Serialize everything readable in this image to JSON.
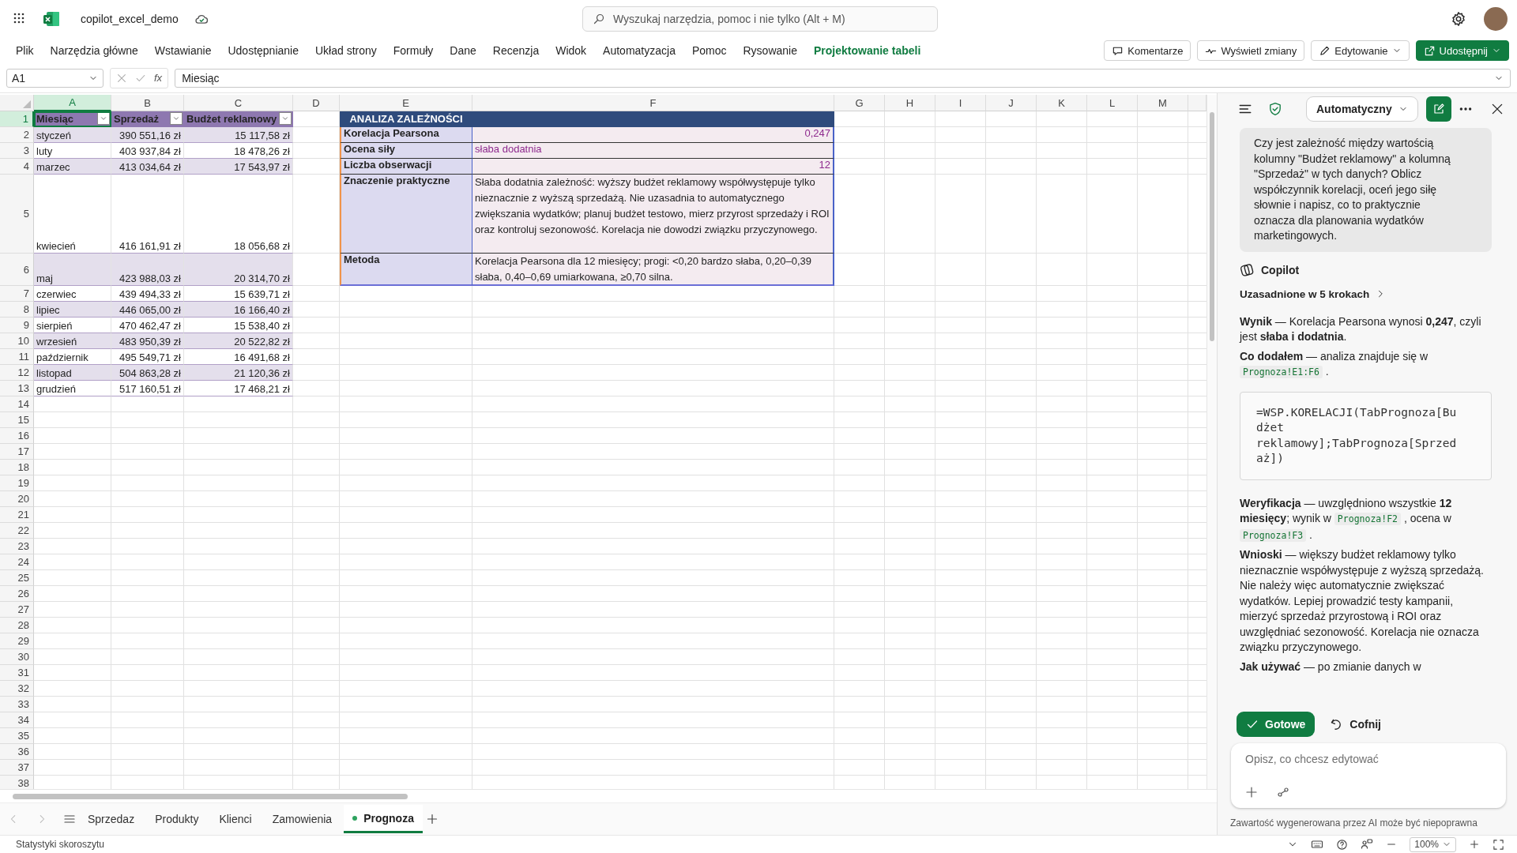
{
  "app": {
    "title": "copilot_excel_demo"
  },
  "search": {
    "placeholder": "Wyszukaj narzędzia, pomoc i nie tylko (Alt + M)"
  },
  "ribbon": {
    "tabs": [
      {
        "label": "Plik",
        "kind": "normal"
      },
      {
        "label": "Narzędzia główne",
        "kind": "normal"
      },
      {
        "label": "Wstawianie",
        "kind": "normal"
      },
      {
        "label": "Udostępnianie",
        "kind": "normal"
      },
      {
        "label": "Układ strony",
        "kind": "normal"
      },
      {
        "label": "Formuły",
        "kind": "normal"
      },
      {
        "label": "Dane",
        "kind": "normal"
      },
      {
        "label": "Recenzja",
        "kind": "normal"
      },
      {
        "label": "Widok",
        "kind": "normal"
      },
      {
        "label": "Automatyzacja",
        "kind": "normal"
      },
      {
        "label": "Pomoc",
        "kind": "normal"
      },
      {
        "label": "Rysowanie",
        "kind": "normal"
      },
      {
        "label": "Projektowanie tabeli",
        "kind": "contextual"
      }
    ],
    "actions": [
      {
        "label": "Komentarze",
        "kind": "comments"
      },
      {
        "label": "Wyświetl zmiany",
        "kind": "changes"
      },
      {
        "label": "Edytowanie",
        "kind": "mode"
      },
      {
        "label": "Udostępnij",
        "kind": "share"
      }
    ]
  },
  "formula_bar": {
    "name_box": "A1",
    "function_label": "fx",
    "value": "Miesiąc"
  },
  "sheet": {
    "columns": [
      {
        "label": "A",
        "selected": true
      },
      {
        "label": "B",
        "selected": false
      },
      {
        "label": "C",
        "selected": false
      },
      {
        "label": "D",
        "selected": false
      },
      {
        "label": "E",
        "selected": false
      },
      {
        "label": "F",
        "selected": false
      },
      {
        "label": "G",
        "selected": false
      },
      {
        "label": "H",
        "selected": false
      },
      {
        "label": "I",
        "selected": false
      },
      {
        "label": "J",
        "selected": false
      },
      {
        "label": "K",
        "selected": false
      },
      {
        "label": "L",
        "selected": false
      },
      {
        "label": "M",
        "selected": false
      }
    ],
    "rows": [
      {
        "label": "1",
        "selected": true
      },
      {
        "label": "2",
        "selected": false
      },
      {
        "label": "3",
        "selected": false
      },
      {
        "label": "4",
        "selected": false
      },
      {
        "label": "5",
        "selected": false
      },
      {
        "label": "6",
        "selected": false
      },
      {
        "label": "7",
        "selected": false
      },
      {
        "label": "8",
        "selected": false
      },
      {
        "label": "9",
        "selected": false
      },
      {
        "label": "10",
        "selected": false
      },
      {
        "label": "11",
        "selected": false
      },
      {
        "label": "12",
        "selected": false
      },
      {
        "label": "13",
        "selected": false
      },
      {
        "label": "14",
        "selected": false
      },
      {
        "label": "15",
        "selected": false
      },
      {
        "label": "16",
        "selected": false
      },
      {
        "label": "17",
        "selected": false
      },
      {
        "label": "18",
        "selected": false
      },
      {
        "label": "19",
        "selected": false
      },
      {
        "label": "20",
        "selected": false
      },
      {
        "label": "21",
        "selected": false
      },
      {
        "label": "22",
        "selected": false
      },
      {
        "label": "23",
        "selected": false
      },
      {
        "label": "24",
        "selected": false
      },
      {
        "label": "25",
        "selected": false
      },
      {
        "label": "26",
        "selected": false
      },
      {
        "label": "27",
        "selected": false
      },
      {
        "label": "28",
        "selected": false
      },
      {
        "label": "29",
        "selected": false
      },
      {
        "label": "30",
        "selected": false
      },
      {
        "label": "31",
        "selected": false
      },
      {
        "label": "32",
        "selected": false
      },
      {
        "label": "33",
        "selected": false
      },
      {
        "label": "34",
        "selected": false
      },
      {
        "label": "35",
        "selected": false
      },
      {
        "label": "36",
        "selected": false
      },
      {
        "label": "37",
        "selected": false
      },
      {
        "label": "38",
        "selected": false
      }
    ],
    "table": {
      "headers": [
        "Miesiąc",
        "Sprzedaż",
        "Budżet reklamowy"
      ],
      "rows": [
        [
          "styczeń",
          "390 551,16 zł",
          "15 117,58 zł"
        ],
        [
          "luty",
          "403 937,84 zł",
          "18 478,26 zł"
        ],
        [
          "marzec",
          "413 034,64 zł",
          "17 543,97 zł"
        ],
        [
          "kwiecień",
          "416 161,91 zł",
          "18 056,68 zł"
        ],
        [
          "maj",
          "423 988,03 zł",
          "20 314,70 zł"
        ],
        [
          "czerwiec",
          "439 494,33 zł",
          "15 639,71 zł"
        ],
        [
          "lipiec",
          "446 065,00 zł",
          "16 166,40 zł"
        ],
        [
          "sierpień",
          "470 462,47 zł",
          "15 538,40 zł"
        ],
        [
          "wrzesień",
          "483 950,39 zł",
          "20 522,82 zł"
        ],
        [
          "październik",
          "495 549,71 zł",
          "16 491,68 zł"
        ],
        [
          "listopad",
          "504 863,28 zł",
          "21 120,36 zł"
        ],
        [
          "grudzień",
          "517 160,51 zł",
          "17 468,21 zł"
        ]
      ]
    },
    "analysis": {
      "title": "ANALIZA ZALEŻNOŚCI",
      "rows": [
        {
          "label": "Korelacja Pearsona",
          "value": "0,247",
          "kind": "number"
        },
        {
          "label": "Ocena siły",
          "value": "słaba dodatnia",
          "kind": "rating"
        },
        {
          "label": "Liczba obserwacji",
          "value": "12",
          "kind": "number"
        },
        {
          "label": "Znaczenie praktyczne",
          "value": "Słaba dodatnia zależność: wyższy budżet reklamowy współwystępuje tylko nieznacznie z wyższą sprzedażą. Nie uzasadnia to automatycznego zwiększania wydatków; planuj budżet testowo, mierz przyrost sprzedaży i ROI oraz kontroluj sezonowość. Korelacja nie dowodzi związku przyczynowego.",
          "kind": "note"
        },
        {
          "label": "Metoda",
          "value": "Korelacja Pearsona dla 12 miesięcy; progi: <0,20 bardzo słaba, 0,20–0,39 słaba, 0,40–0,69 umiarkowana, ≥0,70 silna.",
          "kind": "note"
        }
      ]
    }
  },
  "sheet_tabs": [
    {
      "label": "Sprzedaz",
      "selected": false
    },
    {
      "label": "Produkty",
      "selected": false
    },
    {
      "label": "Klienci",
      "selected": false
    },
    {
      "label": "Zamowienia",
      "selected": false
    },
    {
      "label": "Prognoza",
      "selected": true
    }
  ],
  "status_bar": {
    "text": "Statystyki skoroszytu",
    "zoom": "100%"
  },
  "copilot": {
    "mode": "Automatyczny",
    "prompt": "Czy jest zależność między wartością kolumny \"Budżet reklamowy\" a kolumną \"Sprzedaż\" w tych danych? Oblicz współczynnik korelacji, oceń jego siłę słownie i napisz, co to praktycznie oznacza dla planowania wydatków marketingowych.",
    "author": "Copilot",
    "steps_link": "Uzasadnione w 5 krokach",
    "blocks": [
      {
        "kind": "paragraph",
        "segments": [
          {
            "kind": "text",
            "text": "**Wynik** — Korelacja Pearsona wynosi **0,247**, czyli jest **słaba i dodatnia**."
          }
        ]
      },
      {
        "kind": "paragraph",
        "segments": [
          {
            "kind": "text",
            "text": "**Co dodałem** — analiza znajduje się w "
          },
          {
            "kind": "code",
            "text": "Prognoza!E1:F6"
          },
          {
            "kind": "text",
            "text": " ."
          }
        ]
      },
      {
        "kind": "code_block",
        "text": "=WSP.KORELACJI(TabPrognoza[Budżet reklamowy];TabPrognoza[Sprzedaż])"
      },
      {
        "kind": "paragraph",
        "segments": [
          {
            "kind": "text",
            "text": "**Weryfikacja** — uwzględniono wszystkie **12 miesięcy**; wynik w "
          },
          {
            "kind": "code",
            "text": "Prognoza!F2"
          },
          {
            "kind": "text",
            "text": " , ocena w "
          },
          {
            "kind": "code",
            "text": "Prognoza!F3"
          },
          {
            "kind": "text",
            "text": " ."
          }
        ]
      },
      {
        "kind": "paragraph",
        "segments": [
          {
            "kind": "text",
            "text": "**Wnioski** — większy budżet reklamowy tylko nieznacznie współwystępuje z wyższą sprzedażą. Nie należy więc automatycznie zwiększać wydatków. Lepiej prowadzić testy kampanii, mierzyć sprzedaż przyrostową i ROI oraz uwzględniać sezonowość. Korelacja nie oznacza związku przyczynowego."
          }
        ]
      },
      {
        "kind": "paragraph",
        "segments": [
          {
            "kind": "text",
            "text": "**Jak używać** — po zmianie danych w"
          }
        ]
      }
    ],
    "actions": [
      {
        "label": "Gotowe",
        "kind": "primary"
      },
      {
        "label": "Cofnij",
        "kind": "undo"
      }
    ],
    "input": {
      "placeholder": "Opisz, co chcesz edytować"
    },
    "disclaimer": "Zawartość wygenerowana przez AI może być niepoprawna"
  }
}
